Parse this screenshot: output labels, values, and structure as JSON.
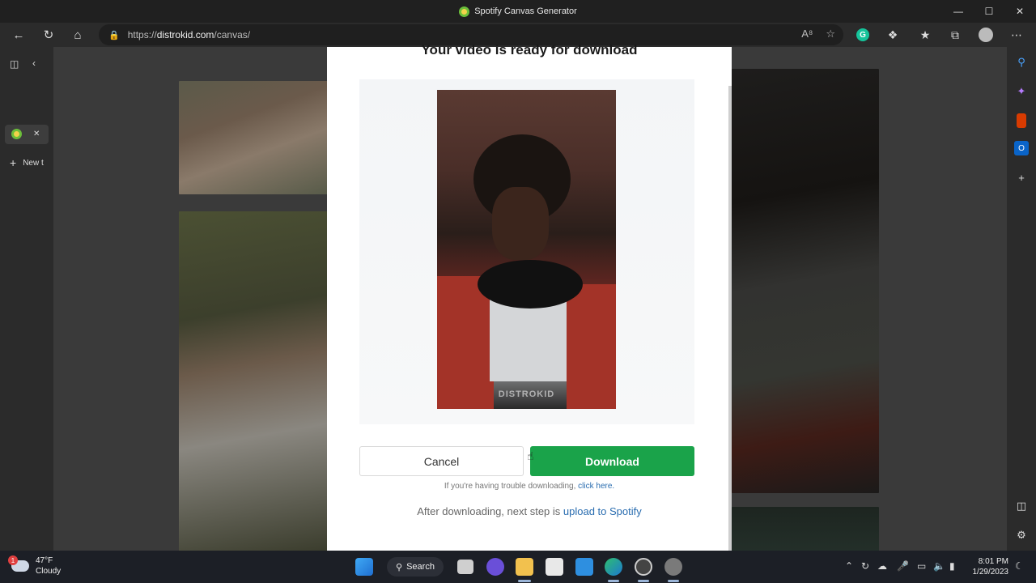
{
  "window": {
    "title": "Spotify Canvas Generator",
    "minimize": "—",
    "maximize": "☐",
    "close": "✕"
  },
  "address_bar": {
    "url_scheme": "https://",
    "url_host": "distrokid.com",
    "url_path": "/canvas/"
  },
  "vertical_tabs": {
    "new_tab_label": "New t",
    "close_tab": "✕"
  },
  "modal": {
    "title": "Your video is ready for download",
    "watermark": "DISTROKID",
    "cancel_label": "Cancel",
    "download_label": "Download",
    "trouble_text": "If you're having trouble downloading, ",
    "trouble_link": "click here.",
    "next_text": "After downloading, next step is ",
    "next_link": "upload to Spotify"
  },
  "taskbar": {
    "temperature": "47°F",
    "condition": "Cloudy",
    "notification_count": "1",
    "search_label": "Search",
    "time": "8:01 PM",
    "date": "1/29/2023"
  },
  "colors": {
    "download_button": "#1aa34a",
    "link": "#2a6db0"
  }
}
